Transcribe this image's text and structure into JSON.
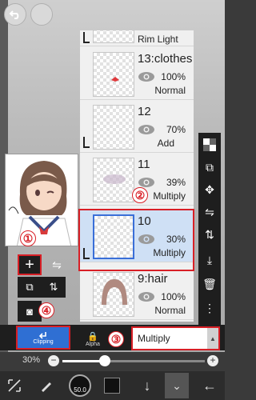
{
  "layers": [
    {
      "name": "13:clothes",
      "opacity": "100%",
      "mode": "Normal"
    },
    {
      "name": "12",
      "opacity": "70%",
      "mode": "Add"
    },
    {
      "name": "11",
      "opacity": "39%",
      "mode": "Multiply"
    },
    {
      "name": "10",
      "opacity": "30%",
      "mode": "Multiply"
    },
    {
      "name": "9:hair",
      "opacity": "100%",
      "mode": "Normal"
    }
  ],
  "partial_layer_name": "Rim Light",
  "markers": [
    "①",
    "②",
    "③",
    "④"
  ],
  "blend": {
    "clipping_label": "Clipping",
    "alpha_label": "Alpha",
    "mode_value": "Multiply"
  },
  "opacity": {
    "label": "30%",
    "value_percent": 30
  },
  "brush_size": "50.0",
  "colors": {
    "accent_red": "#d81f26",
    "selected_blue": "#2f6fd3",
    "layer_selected_bg": "#cfe0f5"
  }
}
